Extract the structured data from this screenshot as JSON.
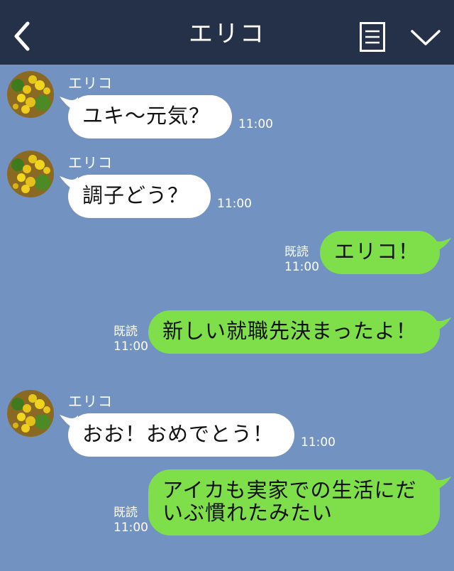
{
  "header": {
    "title": "エリコ",
    "back_icon": "chevron-left-icon",
    "menu_icon": "document-menu-icon",
    "dropdown_icon": "chevron-down-icon"
  },
  "colors": {
    "header_bg": "#253149",
    "chat_bg": "#7293c2",
    "incoming_bubble": "#ffffff",
    "outgoing_bubble": "#7edf4a"
  },
  "messages": [
    {
      "direction": "in",
      "sender": "エリコ",
      "text": "ユキ〜元気？",
      "time": "11:00"
    },
    {
      "direction": "in",
      "sender": "エリコ",
      "text": "調子どう？",
      "time": "11:00"
    },
    {
      "direction": "out",
      "read": "既読",
      "text": "エリコ！",
      "time": "11:00"
    },
    {
      "direction": "out",
      "read": "既読",
      "text": "新しい就職先決まったよ！",
      "time": "11:00"
    },
    {
      "direction": "in",
      "sender": "エリコ",
      "text": "おお！おめでとう！",
      "time": "11:00"
    },
    {
      "direction": "out",
      "read": "既読",
      "text_lines": [
        "アイカも実家での生活にだ",
        "いぶ慣れたみたい"
      ],
      "time": "11:00"
    }
  ]
}
